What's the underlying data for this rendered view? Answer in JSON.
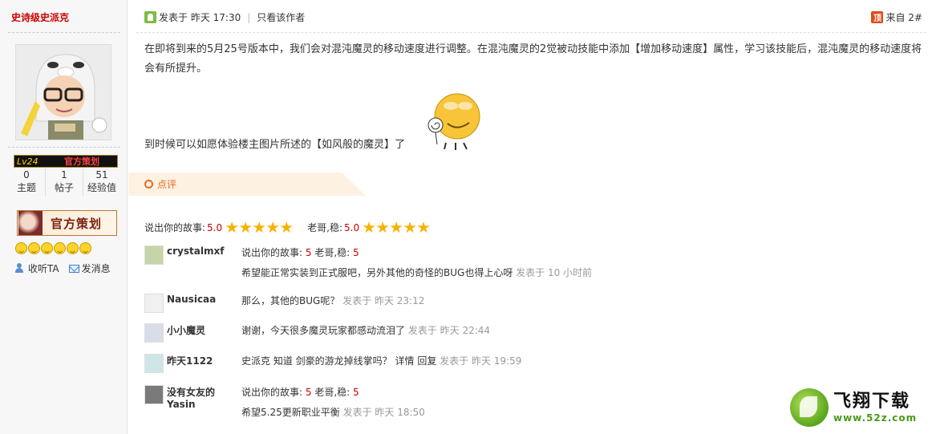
{
  "sidebar": {
    "username": "史诗级史派克",
    "level": "Lv24",
    "role": "官方策划",
    "stats": [
      {
        "num": "0",
        "label": "主题"
      },
      {
        "num": "1",
        "label": "帖子"
      },
      {
        "num": "51",
        "label": "经验值"
      }
    ],
    "badge_text": "官方策划",
    "follow_label": "收听TA",
    "message_label": "发消息"
  },
  "post": {
    "posted_at": "发表于 昨天 17:30",
    "author_only": "只看该作者",
    "floor_icon": "顶",
    "floor": "来自 2#",
    "paragraph1": "在即将到来的5月25号版本中，我们会对混沌魔灵的移动速度进行调整。在混沌魔灵的2觉被动技能中添加【增加移动速度】属性，学习该技能后，混沌魔灵的移动速度将会有所提升。",
    "paragraph2": "到时候可以如愿体验楼主图片所述的【如风般的魔灵】了"
  },
  "review": {
    "tab_label": "点评",
    "ratings": [
      {
        "label": "说出你的故事:",
        "score": "5.0",
        "stars": 5
      },
      {
        "label": "老哥,稳:",
        "score": "5.0",
        "stars": 5
      }
    ]
  },
  "comments": [
    {
      "name": "crystalmxf",
      "rating_line": {
        "a": "说出你的故事:",
        "a_score": "5",
        "b": "老哥,稳:",
        "b_score": "5"
      },
      "text": "希望能正常实装到正式服吧，另外其他的奇怪的BUG也得上心呀",
      "time": "发表于 10 小时前"
    },
    {
      "name": "Nausicaa",
      "text": "那么，其他的BUG呢？",
      "time": "发表于 昨天 23:12"
    },
    {
      "name": "小小魔灵",
      "text": "谢谢，今天很多魔灵玩家都感动流泪了",
      "time": "发表于 昨天 22:44"
    },
    {
      "name": "昨天1122",
      "text": "史派克 知道 剑豪的游龙掉线掌吗？",
      "detail": "详情",
      "reply": "回复",
      "time": "发表于 昨天 19:59"
    },
    {
      "name": "没有女友的Yasin",
      "rating_line": {
        "a": "说出你的故事:",
        "a_score": "5",
        "b": "老哥,稳:",
        "b_score": "5"
      },
      "text": "希望5.25更新职业平衡",
      "time": "发表于 昨天 18:50"
    }
  ],
  "watermark": {
    "name": "飞翔下载",
    "url": "www.52z.com"
  },
  "colors": {
    "accent": "#ea6a1f",
    "score_red": "#cc0000",
    "tab_bg": "#fdf2e2"
  }
}
